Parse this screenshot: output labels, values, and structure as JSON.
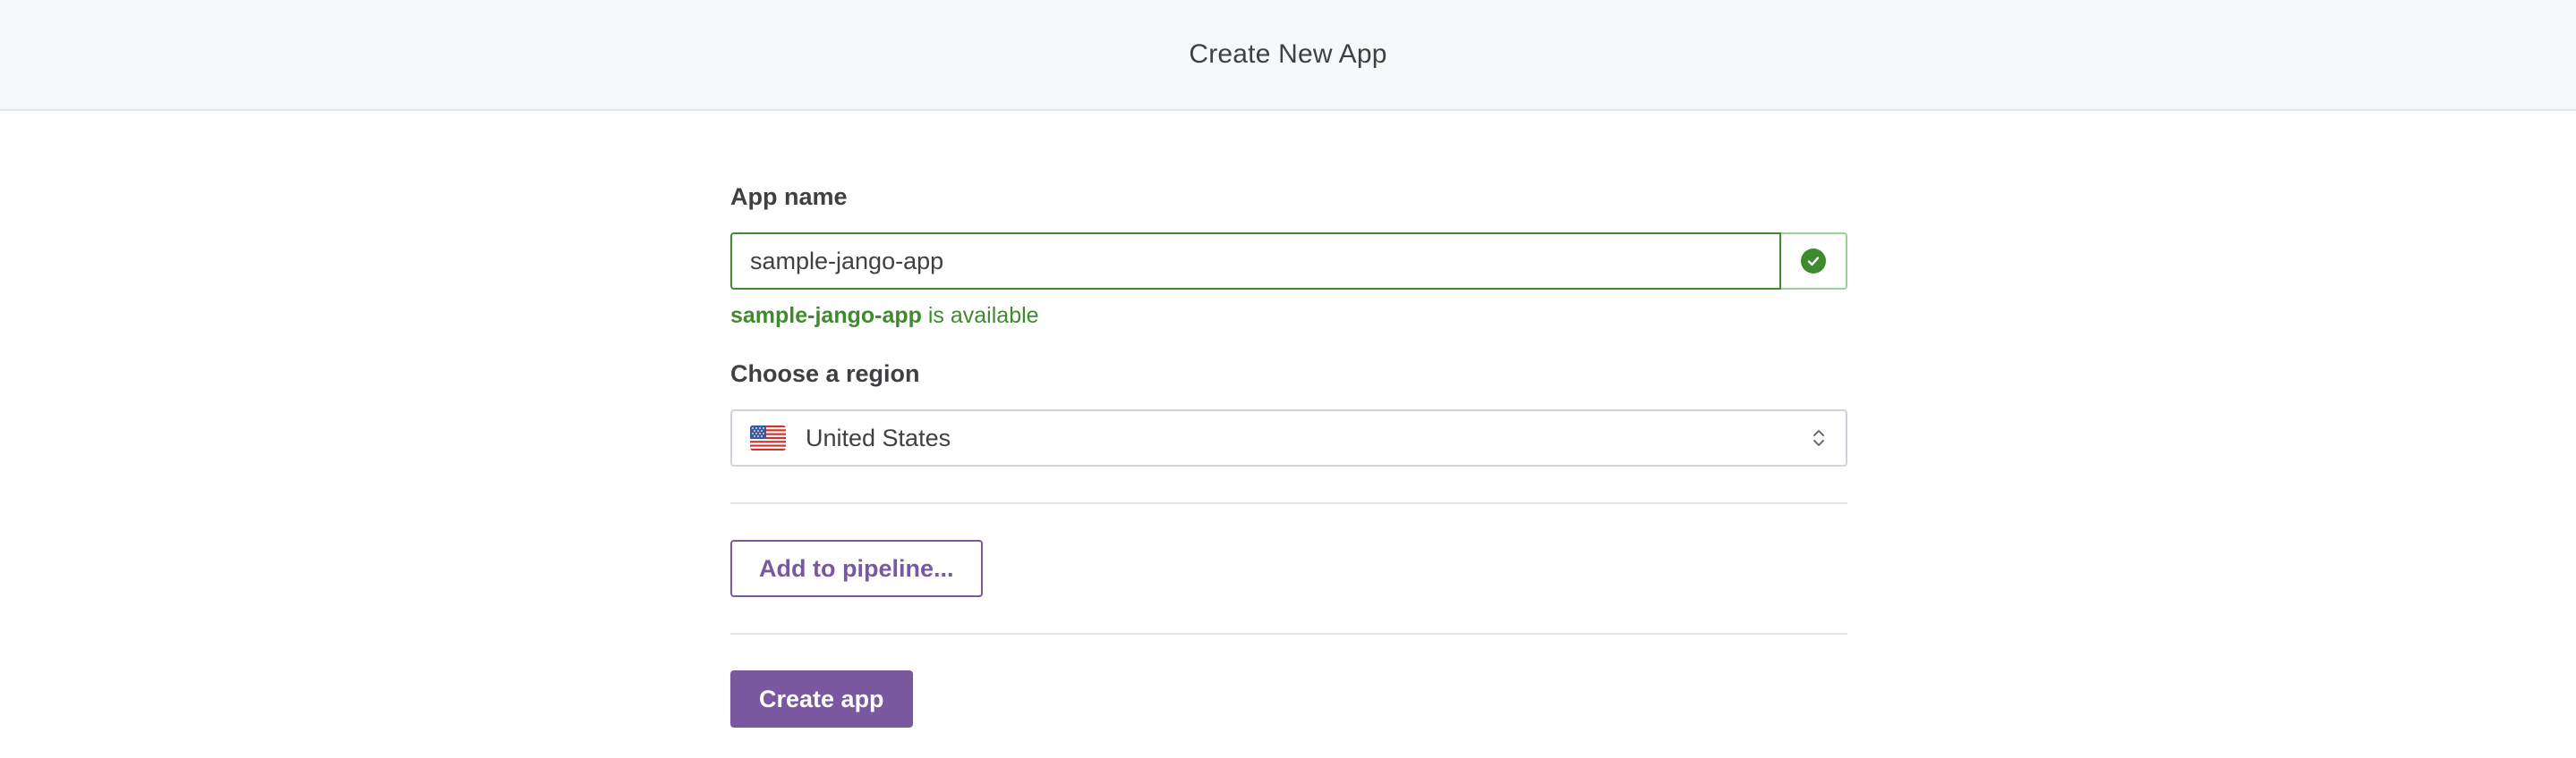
{
  "header": {
    "title": "Create New App"
  },
  "app_name": {
    "label": "App name",
    "value": "sample-jango-app",
    "status_icon": "check-circle-icon",
    "availability_name": "sample-jango-app",
    "availability_suffix": " is available"
  },
  "region": {
    "label": "Choose a region",
    "selected": "United States",
    "flag_icon": "us-flag-icon"
  },
  "buttons": {
    "pipeline_label": "Add to pipeline...",
    "create_label": "Create app"
  },
  "colors": {
    "accent": "#79589f",
    "success": "#3f8a2e",
    "header_bg": "#f7f8fb"
  }
}
